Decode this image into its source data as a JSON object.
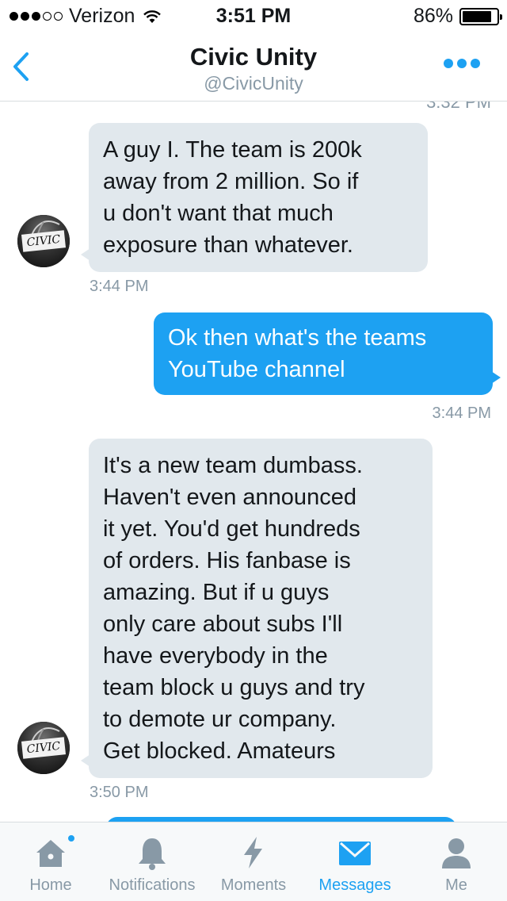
{
  "status_bar": {
    "carrier": "Verizon",
    "time": "3:51 PM",
    "battery": "86%",
    "battery_level": 0.86,
    "signal_filled": 3,
    "signal_total": 5
  },
  "header": {
    "title": "Civic Unity",
    "handle": "@CivicUnity",
    "back_icon": "chevron-left-icon",
    "more_icon": "more-dots-icon"
  },
  "colors": {
    "accent": "#1da1f2",
    "incoming_bubble": "#e1e8ed",
    "muted": "#8899a6"
  },
  "thread": {
    "cut_timestamp": "3:32 PM",
    "messages": [
      {
        "direction": "incoming",
        "text": "A guy I. The team is 200k\naway from 2 million. So if\nu don't want that much\nexposure than whatever.",
        "time": "3:44 PM"
      },
      {
        "direction": "outgoing",
        "text": "Ok then what's the teams\nYouTube channel",
        "time": "3:44 PM"
      },
      {
        "direction": "incoming",
        "text": "It's a new team dumbass.\nHaven't even announced\nit yet. You'd get hundreds\nof orders. His fanbase is\namazing. But if u guys\nonly care about subs I'll\nhave everybody in the\nteam block u guys and try\nto demote ur company.\nGet blocked. Amateurs",
        "time": "3:50 PM"
      }
    ],
    "avatar_logo_text": "CIVIC"
  },
  "tabbar": {
    "tabs": [
      {
        "label": "Home",
        "icon": "home-icon",
        "active": false,
        "badge": true
      },
      {
        "label": "Notifications",
        "icon": "bell-icon",
        "active": false,
        "badge": false
      },
      {
        "label": "Moments",
        "icon": "lightning-icon",
        "active": false,
        "badge": false
      },
      {
        "label": "Messages",
        "icon": "envelope-icon",
        "active": true,
        "badge": false
      },
      {
        "label": "Me",
        "icon": "person-icon",
        "active": false,
        "badge": false
      }
    ]
  }
}
